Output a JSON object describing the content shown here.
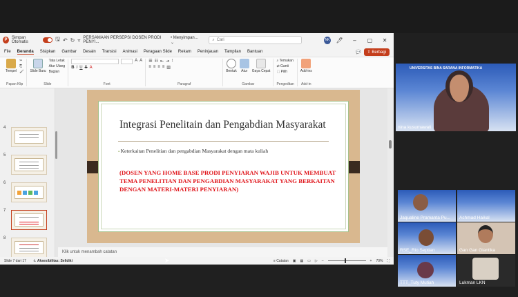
{
  "ppt": {
    "autosave_label": "Simpan Otomatis",
    "doc_title": "PERSAMAAN PERSEPSI DOSEN PRODI PENYI...",
    "doc_status": "• Menyimpan... ⌄",
    "search_placeholder": "Cari",
    "user_initials": "NK",
    "menu": [
      "File",
      "Beranda",
      "Sisipkan",
      "Gambar",
      "Desain",
      "Transisi",
      "Animasi",
      "Peragaan Slide",
      "Rekam",
      "Peninjauan",
      "Tampilan",
      "Bantuan"
    ],
    "share_label": "Berbagi",
    "ribbon": {
      "paste": "Tempel",
      "clipboard_label": "Papan Klip",
      "new_slide": "Slide Baru",
      "layout": "Tata Letak",
      "reset": "Atur Ulang",
      "section": "Bagian",
      "slide_label": "Slide",
      "font_label": "Font",
      "paragraph_label": "Paragraf",
      "shapes": "Bentuk",
      "arrange": "Atur",
      "quick_styles": "Gaya Cepat",
      "drawing_label": "Gambar",
      "find": "Temukan",
      "replace": "Ganti",
      "select": "Pilih",
      "editing_label": "Pengeditan",
      "addins": "Add-ins",
      "addins_label": "Add-in"
    },
    "thumb_numbers": [
      "4",
      "5",
      "6",
      "7",
      "8",
      "9"
    ],
    "slide": {
      "title": "Integrasi Penelitain dan Pengabdian Masyarakat",
      "bullet": "Keterkaitan Penelitian dan pengabdian Masyarakat dengan mata kuliah",
      "red_text": "(DOSEN YANG HOME BASE PRODI PENYIARAN WAJIB UNTUK MEMBUAT TEMA PENELITIAN DAN PENGABDIAN MASYARAKAT YANG BERKAITAN DENGAN MATERI-MATERI PENYIARAN)"
    },
    "notes_placeholder": "Klik untuk menambah catatan",
    "status": {
      "slide_count": "Slide 7 dari 17",
      "accessibility": "Aksesibilitas: Selidiki",
      "notes": "Catatan",
      "zoom": "70%"
    }
  },
  "participants": {
    "main_banner": "UNIVERSITAS BINA SARANA INFORMATIKA",
    "main_name": "nina kusumawati",
    "tiles": [
      {
        "name": "Jaqualine Pramanta Pu..."
      },
      {
        "name": "Achmad Haikal"
      },
      {
        "name": "RSE_Rio Septian"
      },
      {
        "name": "Gan Gan Giantika"
      },
      {
        "name": "TTT_Tuty Mutiah"
      },
      {
        "name": "Lukman LKN"
      }
    ]
  },
  "colors": {
    "accent": "#c43e1c",
    "slide_red": "#e0151b",
    "slide_frame": "#d9b88f"
  }
}
